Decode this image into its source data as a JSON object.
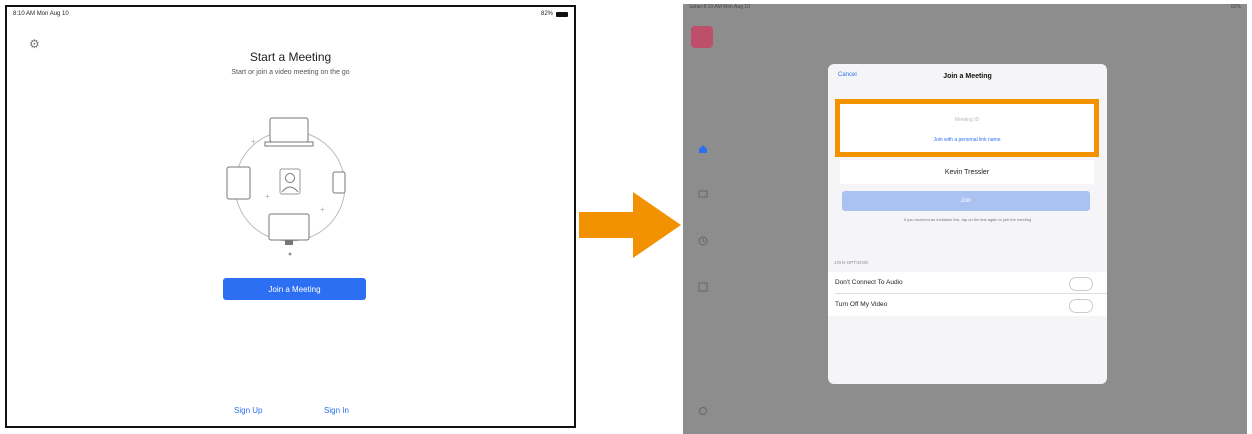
{
  "left": {
    "status": {
      "time": "8:10 AM",
      "date": "Mon Aug 10",
      "battery": "82%"
    },
    "title": "Start a Meeting",
    "subtitle": "Start or join a video meeting on the go",
    "join_button": "Join a Meeting",
    "sign_up": "Sign Up",
    "sign_in": "Sign In"
  },
  "right": {
    "status": {
      "left": "Safari 8:10 AM Mon Aug 10",
      "right": "82%"
    },
    "modal": {
      "cancel": "Cancel",
      "title": "Join a Meeting",
      "meeting_id_placeholder": "Meeting ID",
      "personal_link": "Join with a personal link name",
      "name_value": "Kevin Tressler",
      "join": "Join",
      "hint": "If you received an invitation link, tap on the link again to join the meeting",
      "join_options_header": "JOIN OPTIONS",
      "options": [
        {
          "label": "Don't Connect To Audio",
          "enabled": false
        },
        {
          "label": "Turn Off My Video",
          "enabled": false
        }
      ]
    }
  },
  "colors": {
    "accent_blue": "#2d6ff2",
    "highlight_orange": "#f39200",
    "arrow_orange": "#f39200",
    "overlay_gray": "#8d8d8e"
  },
  "icons": [
    "gear-icon",
    "home-icon",
    "chat-icon",
    "clock-icon",
    "contacts-icon",
    "settings-icon",
    "arrow-right-icon"
  ]
}
